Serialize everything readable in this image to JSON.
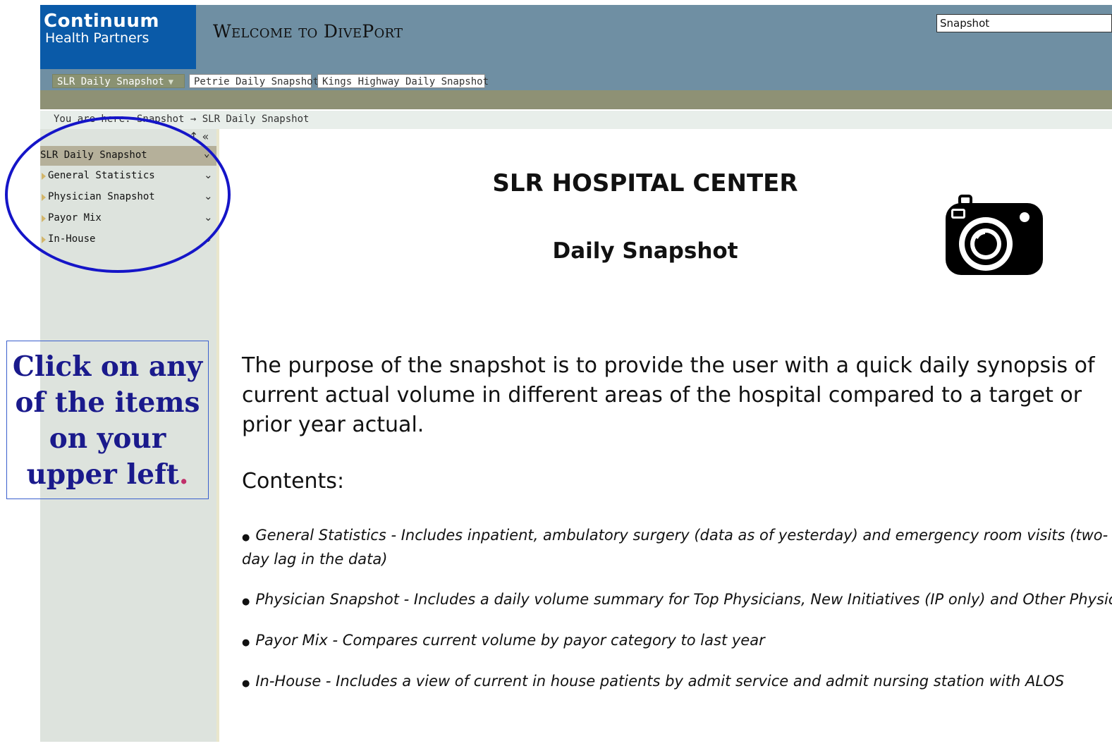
{
  "header": {
    "logo_line1": "Continuum",
    "logo_line2": "Health Partners",
    "welcome": "Welcome to DivePort",
    "search_value": "Snapshot"
  },
  "tabs": [
    {
      "label": "SLR Daily Snapshot",
      "active": true
    },
    {
      "label": "Petrie Daily Snapshot",
      "active": false
    },
    {
      "label": "Kings Highway Daily Snapshot",
      "active": false
    }
  ],
  "breadcrumb": "You are here: Snapshot → SLR Daily Snapshot",
  "sidebar": {
    "tools": "↑ «",
    "header": "SLR Daily Snapshot",
    "items": [
      {
        "label": "General Statistics"
      },
      {
        "label": "Physician Snapshot"
      },
      {
        "label": "Payor Mix"
      },
      {
        "label": "In-House"
      }
    ]
  },
  "callout": {
    "text": "Click on any of the items on your upper left",
    "period": "."
  },
  "main": {
    "title": "SLR HOSPITAL CENTER",
    "subtitle": "Daily Snapshot",
    "purpose": "The purpose of the snapshot is to provide the user with a quick daily synopsis of current actual volume in different areas of the hospital compared to a target or prior year actual.",
    "contents_label": "Contents:",
    "contents": [
      "General Statistics - Includes inpatient, ambulatory surgery (data as of yesterday) and emergency room visits (two-day lag in the data)",
      "Physician Snapshot - Includes a daily volume summary for Top Physicians, New Initiatives (IP only) and Other Physicians",
      "Payor Mix - Compares current volume by payor category to last year",
      "In-House - Includes a view of current in house patients by admit service and admit nursing station with ALOS"
    ]
  },
  "colors": {
    "header_bg": "#6f8fa3",
    "logo_bg": "#0a5aa8",
    "olive_bar": "#8e9175",
    "sidebar_bg": "#dde3dd",
    "annotation_blue": "#1515c8"
  },
  "icons": [
    "camera-icon",
    "chevron-down-icon",
    "collapse-icon",
    "triangle-right-icon"
  ]
}
